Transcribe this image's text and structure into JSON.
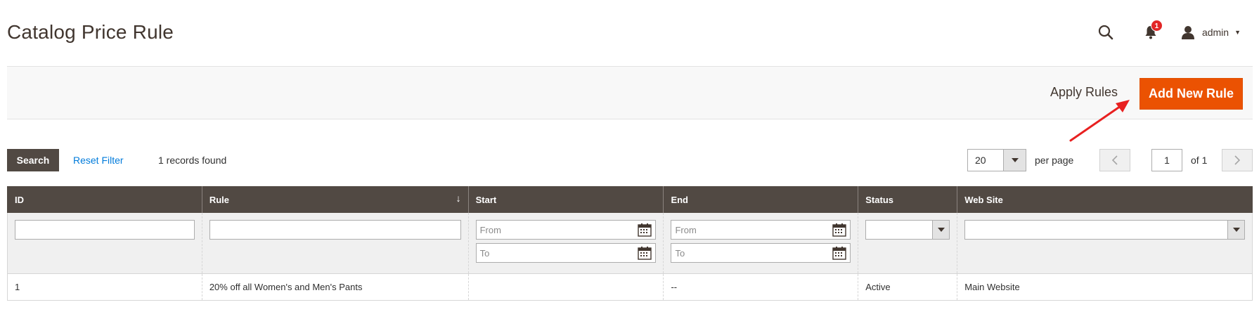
{
  "header": {
    "title": "Catalog Price Rule",
    "notification_count": "1",
    "user_name": "admin"
  },
  "actions": {
    "apply_rules_label": "Apply Rules",
    "add_new_rule_label": "Add New Rule",
    "accent_color": "#eb5202",
    "annotation_arrow_color": "#e82020"
  },
  "toolbar": {
    "search_label": "Search",
    "reset_filter_label": "Reset Filter",
    "records_found": "1 records found",
    "per_page_value": "20",
    "per_page_label": "per page",
    "current_page": "1",
    "page_total": "of 1"
  },
  "grid": {
    "columns": [
      {
        "label": "ID"
      },
      {
        "label": "Rule",
        "sort": "↓"
      },
      {
        "label": "Start"
      },
      {
        "label": "End"
      },
      {
        "label": "Status"
      },
      {
        "label": "Web Site"
      }
    ],
    "filters": {
      "start_from_placeholder": "From",
      "start_to_placeholder": "To",
      "end_from_placeholder": "From",
      "end_to_placeholder": "To"
    },
    "rows": [
      {
        "id": "1",
        "rule": "20% off all Women's and Men's Pants",
        "start": "",
        "end": "--",
        "status": "Active",
        "website": "Main Website"
      }
    ]
  }
}
